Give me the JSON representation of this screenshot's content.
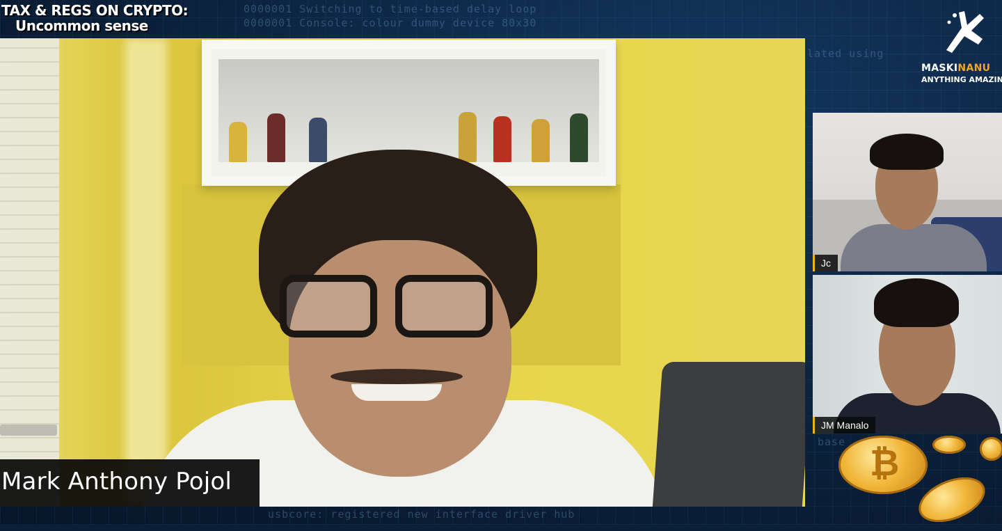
{
  "show": {
    "title_line1": "TAX & REGS ON CRYPTO:",
    "title_line2": "Uncommon sense"
  },
  "background_code": [
    "0000001 Switching to time-based delay loop",
    "0000001 Console: colour dummy device 80x30",
    "lated using",
    "base",
    "usbcore: registered new interface driver hub"
  ],
  "main_participant": {
    "name": "Mark Anthony Pojol"
  },
  "participants": [
    {
      "name": "Jc"
    },
    {
      "name": "JM Manalo"
    }
  ],
  "brand": {
    "name_main": "MASKI",
    "name_accent": "NANU",
    "tagline": "ANYTHING AMAZING"
  },
  "coins": {
    "symbol": "₿"
  },
  "colors": {
    "label_accent": "#f0b020",
    "brand_accent": "#f0a62a",
    "background": "#0a1f38"
  }
}
